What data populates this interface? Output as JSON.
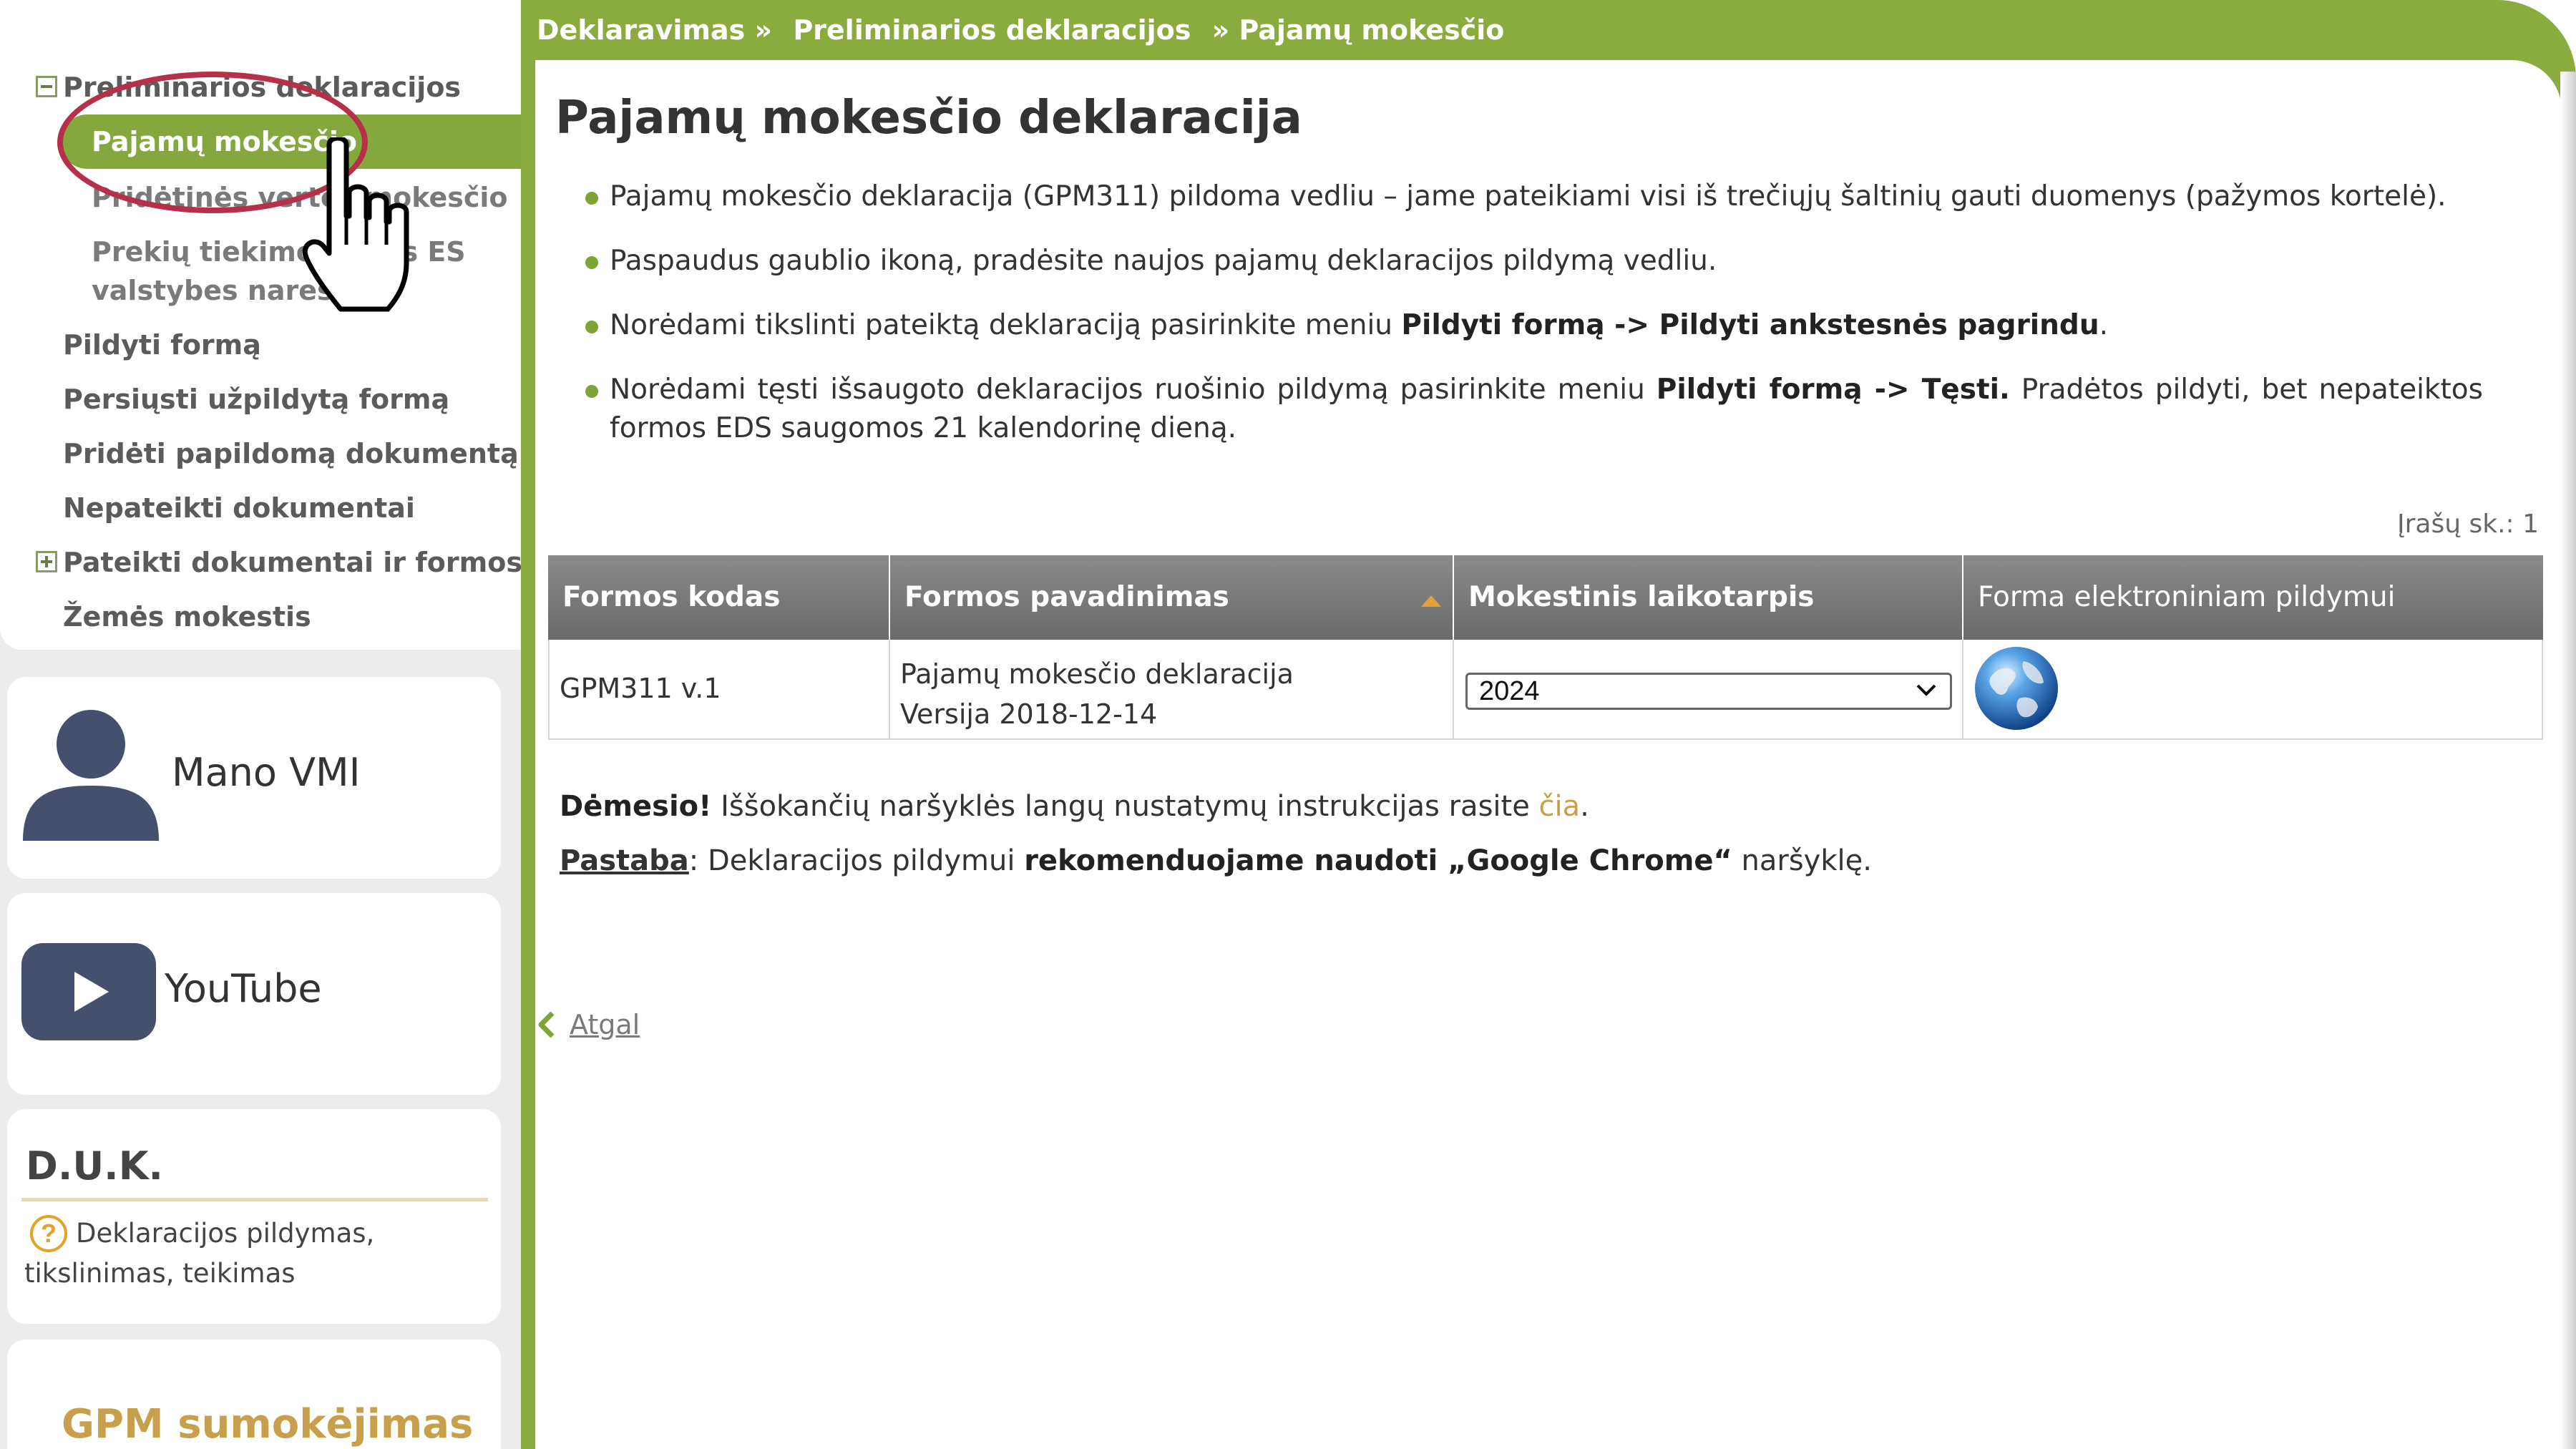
{
  "breadcrumb": {
    "items": [
      "Deklaravimas »",
      "Preliminarios deklaracijos",
      "» Pajamų mokesčio"
    ]
  },
  "sidebar": {
    "tree": {
      "group_title": "Preliminarios deklaracijos",
      "children": [
        "Pajamų mokesčio",
        "Pridėtinės vertės mokesčio",
        "Prekių tiekimo į kitas ES",
        "valstybes nares"
      ],
      "items": [
        "Pildyti formą",
        "Persiųsti užpildytą formą",
        "Pridėti papildomą dokumentą",
        "Nepateikti dokumentai",
        "Pateikti dokumentai ir formos",
        "Žemės mokestis"
      ]
    },
    "cards": {
      "mano_vmi": "Mano VMI",
      "youtube": "YouTube",
      "duk_title": "D.U.K.",
      "duk_link": "Deklaracijos pildymas, tikslinimas, teikimas",
      "gpm_title": "GPM sumokėjimas"
    }
  },
  "main": {
    "title": "Pajamų mokesčio deklaracija",
    "bullets": [
      {
        "text": "Pajamų mokesčio deklaracija (GPM311) pildoma vedliu – jame pateikiami visi iš trečiųjų šaltinių gauti duomenys (pažymos kortelė)."
      },
      {
        "text": "Paspaudus gaublio ikoną, pradėsite naujos pajamų deklaracijos pildymą vedliu."
      },
      {
        "pre": "Norėdami tikslinti pateiktą deklaraciją pasirinkite meniu ",
        "bold": "Pildyti formą -> Pildyti ankstesnės pagrindu",
        "post": "."
      },
      {
        "pre": "Norėdami tęsti išsaugoto deklaracijos ruošinio pildymą pasirinkite meniu ",
        "bold": "Pildyti formą -> Tęsti.",
        "post": " Pradėtos pildyti, bet nepateiktos formos EDS saugomos 21 kalendorinę dieną."
      }
    ],
    "record_count": "Įrašų sk.: 1",
    "table": {
      "headers": [
        "Formos kodas",
        "Formos pavadinimas",
        "Mokestinis laikotarpis",
        "Forma elektroniniam pildymui"
      ],
      "rows": [
        {
          "code": "GPM311 v.1",
          "name": "Pajamų mokesčio deklaracija",
          "version": "Versija 2018-12-14",
          "period": "2024"
        }
      ]
    },
    "notes": {
      "attention_label": "Dėmesio!",
      "attention_text": " Iššokančių naršyklės langų nustatymų instrukcijas rasite ",
      "attention_link": "čia",
      "attention_end": ".",
      "note_label": "Pastaba",
      "note_text": ": Deklaracijos pildymui ",
      "note_bold": "rekomenduojame naudoti „Google Chrome“",
      "note_end": " naršyklę."
    },
    "back_link": "Atgal"
  },
  "colors": {
    "accent_green": "#84a83d",
    "highlight_red": "#b53048",
    "link_gold": "#c8a04b",
    "table_header": "#7a7a7a"
  }
}
